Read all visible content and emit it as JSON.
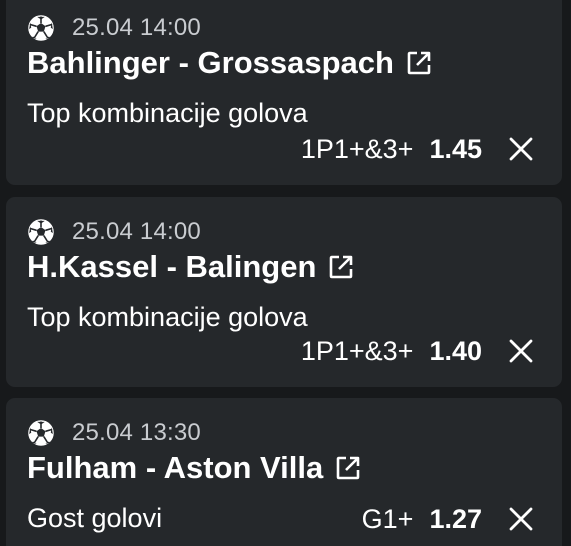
{
  "tickets": [
    {
      "datetime": "25.04 14:00",
      "match": "Bahlinger - Grossaspach",
      "market": "Top kombinacije golova",
      "pick": "1P1+&3+",
      "odd": "1.45",
      "sport_icon": "soccer-ball-icon",
      "link_icon": "external-link-icon",
      "remove_icon": "close-icon"
    },
    {
      "datetime": "25.04 14:00",
      "match": "H.Kassel - Balingen",
      "market": "Top kombinacije golova",
      "pick": "1P1+&3+",
      "odd": "1.40",
      "sport_icon": "soccer-ball-icon",
      "link_icon": "external-link-icon",
      "remove_icon": "close-icon"
    },
    {
      "datetime": "25.04 13:30",
      "match": "Fulham - Aston Villa",
      "market": "Gost golovi",
      "pick": "G1+",
      "odd": "1.27",
      "sport_icon": "soccer-ball-icon",
      "link_icon": "external-link-icon",
      "remove_icon": "close-icon"
    }
  ],
  "colors": {
    "background": "#17191b",
    "card": "#25282b",
    "text": "#ffffff",
    "muted": "#c9ccd0"
  }
}
